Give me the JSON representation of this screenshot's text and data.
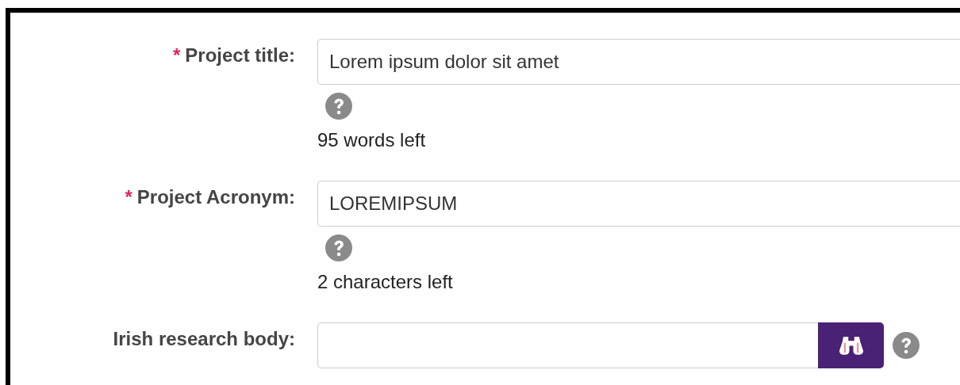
{
  "fields": [
    {
      "kind": "text",
      "marker": "*",
      "label": "Project title:",
      "value": "Lorem ipsum dolor sit amet",
      "counter": "95 words left"
    },
    {
      "kind": "text",
      "marker": "*",
      "label": "Project Acronym:",
      "value": "LOREMIPSUM",
      "counter": "2 characters left"
    },
    {
      "kind": "lookup",
      "label": "Irish research body:"
    }
  ]
}
